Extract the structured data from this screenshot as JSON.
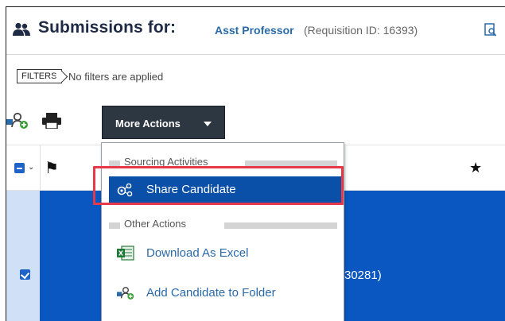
{
  "header": {
    "title_prefix": "Submissions for:",
    "requisition_name": "Asst Professor",
    "requisition_id": "(Requisition ID: 16393)"
  },
  "filters": {
    "tag": "FILTERS",
    "status": "No filters are applied"
  },
  "toolbar": {
    "more_actions_label": "More Actions"
  },
  "dropdown": {
    "sections": [
      {
        "label": "Sourcing Activities",
        "items": [
          {
            "label": "Share Candidate",
            "icon": "share-candidate-icon",
            "highlighted": true
          }
        ]
      },
      {
        "label": "Other Actions",
        "items": [
          {
            "label": "Download As Excel",
            "icon": "excel-icon"
          },
          {
            "label": "Add Candidate to Folder",
            "icon": "add-to-folder-icon"
          }
        ]
      }
    ]
  },
  "table": {
    "row_partial_text": "30281)"
  },
  "colors": {
    "accent_blue": "#2a6aa8",
    "selected_row": "#0a57c2",
    "highlight_border": "#e6394a",
    "button_dark": "#2d3742"
  }
}
